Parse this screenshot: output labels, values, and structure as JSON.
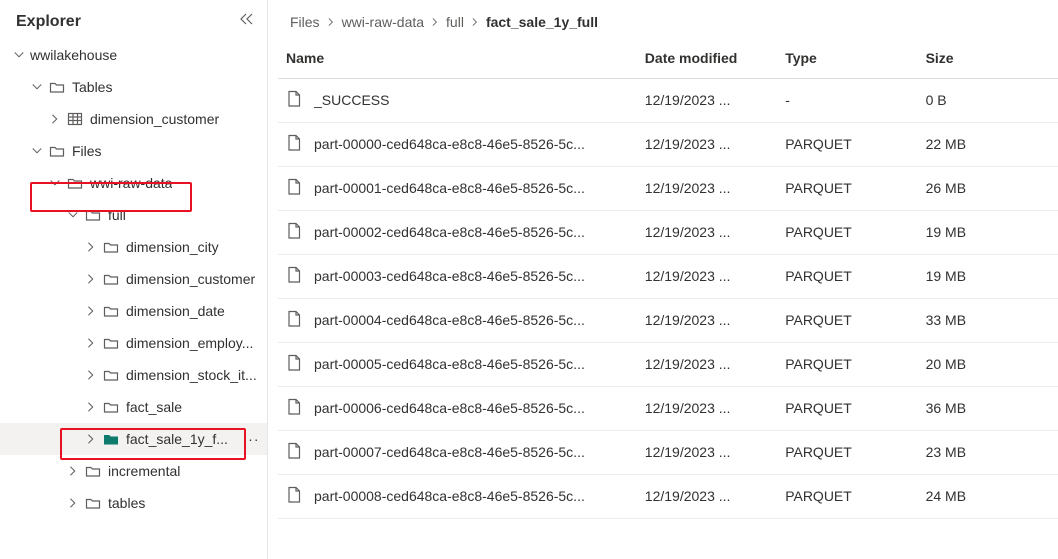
{
  "sidebar": {
    "title": "Explorer",
    "root_label": "wwilakehouse",
    "tables_label": "Tables",
    "dimension_customer_table_label": "dimension_customer",
    "files_label": "Files",
    "wwi_raw_data_label": "wwi-raw-data",
    "full_label": "full",
    "full_children": [
      "dimension_city",
      "dimension_customer",
      "dimension_date",
      "dimension_employ...",
      "dimension_stock_it...",
      "fact_sale",
      "fact_sale_1y_f..."
    ],
    "incremental_label": "incremental",
    "tables_folder_label": "tables",
    "more_glyph": "···"
  },
  "breadcrumb": {
    "items": [
      "Files",
      "wwi-raw-data",
      "full",
      "fact_sale_1y_full"
    ]
  },
  "columns": {
    "name": "Name",
    "date": "Date modified",
    "type": "Type",
    "size": "Size"
  },
  "files": [
    {
      "name": "_SUCCESS",
      "date": "12/19/2023 ...",
      "type": "-",
      "size": "0 B"
    },
    {
      "name": "part-00000-ced648ca-e8c8-46e5-8526-5c...",
      "date": "12/19/2023 ...",
      "type": "PARQUET",
      "size": "22 MB"
    },
    {
      "name": "part-00001-ced648ca-e8c8-46e5-8526-5c...",
      "date": "12/19/2023 ...",
      "type": "PARQUET",
      "size": "26 MB"
    },
    {
      "name": "part-00002-ced648ca-e8c8-46e5-8526-5c...",
      "date": "12/19/2023 ...",
      "type": "PARQUET",
      "size": "19 MB"
    },
    {
      "name": "part-00003-ced648ca-e8c8-46e5-8526-5c...",
      "date": "12/19/2023 ...",
      "type": "PARQUET",
      "size": "19 MB"
    },
    {
      "name": "part-00004-ced648ca-e8c8-46e5-8526-5c...",
      "date": "12/19/2023 ...",
      "type": "PARQUET",
      "size": "33 MB"
    },
    {
      "name": "part-00005-ced648ca-e8c8-46e5-8526-5c...",
      "date": "12/19/2023 ...",
      "type": "PARQUET",
      "size": "20 MB"
    },
    {
      "name": "part-00006-ced648ca-e8c8-46e5-8526-5c...",
      "date": "12/19/2023 ...",
      "type": "PARQUET",
      "size": "36 MB"
    },
    {
      "name": "part-00007-ced648ca-e8c8-46e5-8526-5c...",
      "date": "12/19/2023 ...",
      "type": "PARQUET",
      "size": "23 MB"
    },
    {
      "name": "part-00008-ced648ca-e8c8-46e5-8526-5c...",
      "date": "12/19/2023 ...",
      "type": "PARQUET",
      "size": "24 MB"
    }
  ]
}
